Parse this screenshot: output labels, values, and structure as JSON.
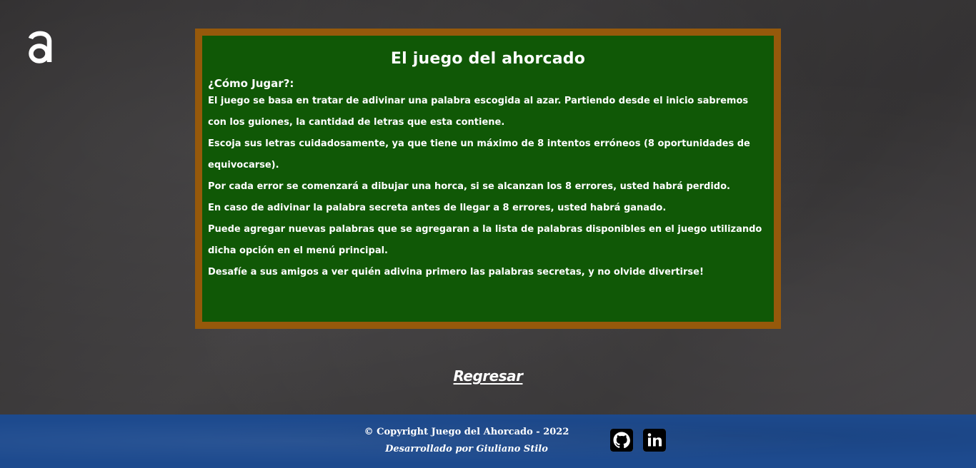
{
  "logo": {
    "icon": "letter-a-logo-icon",
    "color": "#ffffff"
  },
  "board": {
    "title": "El juego del ahorcado",
    "heading": "¿Cómo Jugar?:",
    "rules": [
      "El juego se basa en tratar de adivinar una palabra escogida al azar. Partiendo desde el inicio sabremos con los guiones, la cantidad de letras que esta contiene.",
      "Escoja sus letras cuidadosamente, ya que tiene un máximo de 8 intentos erróneos (8 oportunidades de equivocarse).",
      "Por cada error se comenzará a dibujar una horca, si se alcanzan los 8 errores, usted habrá perdido.",
      "En caso de adivinar la palabra secreta antes de llegar a 8 errores, usted habrá ganado.",
      "Puede agregar nuevas palabras que se agregaran a la lista de palabras disponibles en el juego utilizando dicha opción en el menú principal.",
      "Desafíe a sus amigos a ver quién adivina primero las palabras secretas, y no olvide divertirse!"
    ],
    "background_color": "#105806",
    "border_color": "#96590b"
  },
  "navigation": {
    "back_label": "Regresar"
  },
  "footer": {
    "copyright": "© Copyright Juego del Ahorcado - 2022",
    "developer": "Desarrollado por Giuliano Stilo",
    "social": [
      {
        "icon": "github-icon"
      },
      {
        "icon": "linkedin-icon"
      }
    ],
    "background_color": "#1d4a8e"
  }
}
